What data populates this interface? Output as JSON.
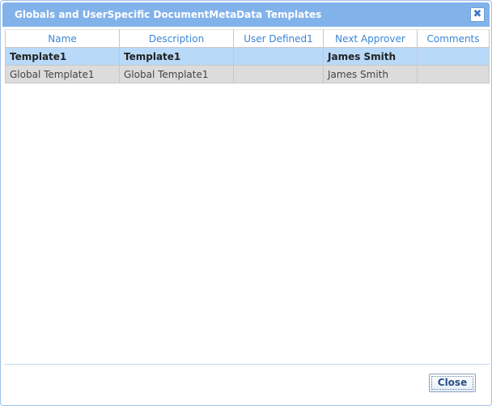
{
  "dialog": {
    "title": "Globals and UserSpecific DocumentMetaData Templates",
    "close_icon": "close-icon",
    "close_glyph": "✖"
  },
  "table": {
    "columns": [
      "Name",
      "Description",
      "User Defined1",
      "Next Approver",
      "Comments"
    ],
    "rows": [
      {
        "name": "Template1",
        "description": "Template1",
        "user_defined1": "",
        "next_approver": "James Smith",
        "comments": "",
        "selected": true
      },
      {
        "name": "Global Template1",
        "description": "Global Template1",
        "user_defined1": "",
        "next_approver": "James Smith",
        "comments": "",
        "selected": false
      }
    ]
  },
  "footer": {
    "close_label": "Close"
  },
  "colors": {
    "titlebar": "#82b2ea",
    "header_text": "#3a86d6",
    "selected_row": "#b9d9f9",
    "normal_row": "#dcdcdc"
  }
}
